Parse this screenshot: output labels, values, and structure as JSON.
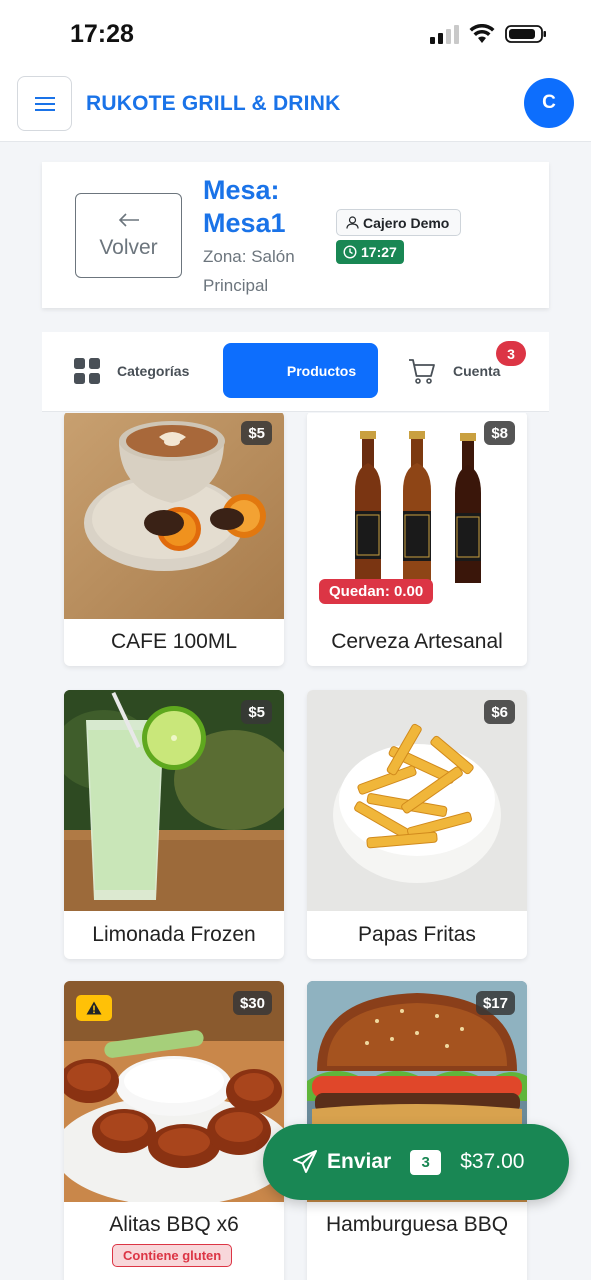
{
  "status_bar": {
    "time": "17:28"
  },
  "header": {
    "brand": "RUKOTE GRILL & DRINK",
    "avatar_initial": "C"
  },
  "table_info": {
    "back_label": "Volver",
    "title": "Mesa: Mesa1",
    "zone": "Zona: Salón Principal",
    "cashier": "Cajero Demo",
    "time": "17:27"
  },
  "tabs": {
    "categories": "Categorías",
    "products": "Productos",
    "account": "Cuenta",
    "account_count": "3",
    "active": "Productos"
  },
  "products": [
    {
      "name": "CAFE 100ML",
      "price": "$5"
    },
    {
      "name": "Cerveza Artesanal",
      "price": "$8",
      "stock_label": "Quedan: 0.00"
    },
    {
      "name": "Limonada Frozen",
      "price": "$5"
    },
    {
      "name": "Papas Fritas",
      "price": "$6"
    },
    {
      "name": "Alitas BBQ x6",
      "price": "$30",
      "allergen": "Contiene gluten"
    },
    {
      "name": "Hamburguesa BBQ",
      "price": "$17"
    }
  ],
  "send": {
    "label": "Enviar",
    "count": "3",
    "total": "$37.00"
  },
  "colors": {
    "primary": "#0d6efd",
    "brand_text": "#1a73e8",
    "success": "#198754",
    "danger": "#dc3545",
    "warning": "#ffc107"
  },
  "icons": [
    "menu-icon",
    "arrow-left-icon",
    "user-icon",
    "clock-icon",
    "grid-icon",
    "cart-icon",
    "warning-icon",
    "send-icon",
    "wifi-icon",
    "battery-icon",
    "signal-icon"
  ]
}
